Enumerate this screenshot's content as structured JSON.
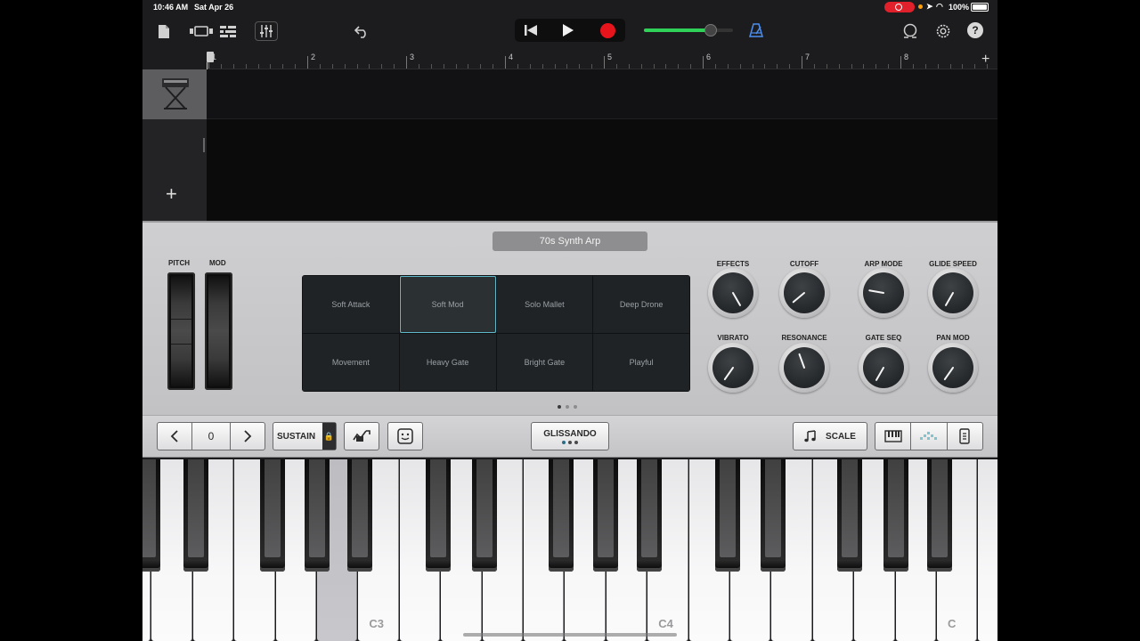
{
  "status_bar": {
    "time": "10:46 AM",
    "date": "Sat Apr 26",
    "battery": "100%"
  },
  "toolbar": {
    "icons": [
      "document-icon",
      "view-toggle-icon",
      "tracks-view-icon",
      "mixer-icon",
      "undo-icon",
      "rewind-icon",
      "play-icon",
      "record-icon",
      "metronome-icon",
      "loop-browser-icon",
      "settings-icon",
      "help-icon"
    ],
    "help_label": "?",
    "volume_level": 0.75,
    "accent_record": "#e8141c",
    "accent_volume": "#30d158"
  },
  "ruler": {
    "bars": [
      "1",
      "2",
      "3",
      "4",
      "5",
      "6",
      "7",
      "8"
    ]
  },
  "tracks": [
    {
      "instrument": "synth-keyboard-icon"
    }
  ],
  "synth": {
    "patch_name": "70s Synth Arp",
    "pitch_label": "PITCH",
    "mod_label": "MOD",
    "presets": [
      {
        "label": "Soft Attack",
        "selected": false
      },
      {
        "label": "Soft Mod",
        "selected": true
      },
      {
        "label": "Solo Mallet",
        "selected": false
      },
      {
        "label": "Deep Drone",
        "selected": false
      },
      {
        "label": "Movement",
        "selected": false
      },
      {
        "label": "Heavy Gate",
        "selected": false
      },
      {
        "label": "Bright Gate",
        "selected": false
      },
      {
        "label": "Playful",
        "selected": false
      }
    ],
    "page_count": 3,
    "page_active": 0,
    "knobs": [
      {
        "label": "EFFECTS",
        "angle": 150
      },
      {
        "label": "CUTOFF",
        "angle": -130
      },
      {
        "label": "ARP MODE",
        "angle": -80
      },
      {
        "label": "GLIDE SPEED",
        "angle": -150
      },
      {
        "label": "VIBRATO",
        "angle": -145
      },
      {
        "label": "RESONANCE",
        "angle": -20
      },
      {
        "label": "GATE SEQ",
        "angle": -150
      },
      {
        "label": "PAN MOD",
        "angle": -145
      }
    ]
  },
  "controls": {
    "octave_value": "0",
    "sustain_label": "SUSTAIN",
    "glissando_label": "GLISSANDO",
    "scale_label": "SCALE",
    "view_modes": [
      "keyboard-view-icon",
      "arpeggiator-view-icon",
      "layout-view-icon"
    ]
  },
  "keyboard": {
    "labels": [
      {
        "text": "C3",
        "key_index": 6
      },
      {
        "text": "C4",
        "key_index": 13
      },
      {
        "text": "C",
        "key_index": 20
      }
    ],
    "pressed_key_index": 5
  }
}
